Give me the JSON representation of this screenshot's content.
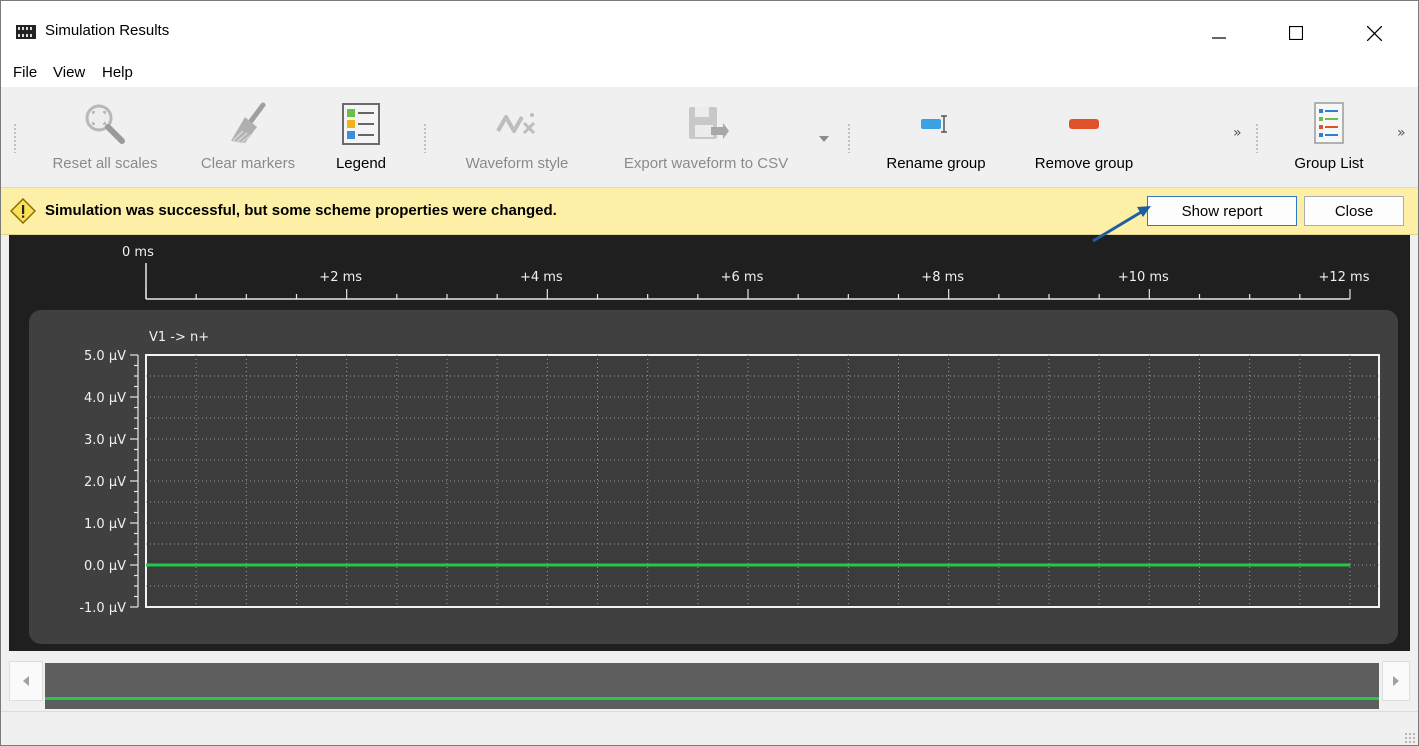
{
  "window": {
    "title": "Simulation Results",
    "controls": {
      "minimize": "—",
      "maximize": "☐",
      "close": "✕"
    }
  },
  "menu": [
    "File",
    "View",
    "Help"
  ],
  "toolbar": {
    "reset_scales": "Reset all scales",
    "clear_markers": "Clear markers",
    "legend": "Legend",
    "waveform_style": "Waveform style",
    "export_csv": "Export waveform to CSV",
    "rename_group": "Rename group",
    "remove_group": "Remove group",
    "group_list": "Group List",
    "overflow": "»"
  },
  "notification": {
    "message": "Simulation was successful, but some scheme properties were changed.",
    "show_report": "Show report",
    "close": "Close"
  },
  "timeline": {
    "ticks": [
      "0 ms",
      "+2 ms",
      "+4 ms",
      "+6 ms",
      "+8 ms",
      "+10 ms",
      "+12 ms"
    ]
  },
  "chart_data": {
    "type": "line",
    "title": "V1 -> n+",
    "xlabel": "",
    "ylabel": "",
    "x_unit": "ms",
    "y_unit": "µV",
    "xlim": [
      0,
      12
    ],
    "ylim": [
      -1.0,
      5.0
    ],
    "y_ticks": [
      "5.0 µV",
      "4.0 µV",
      "3.0 µV",
      "2.0 µV",
      "1.0 µV",
      "0.0 µV",
      "-1.0 µV"
    ],
    "grid": true,
    "series": [
      {
        "x": [
          0,
          12
        ],
        "y": [
          0,
          0
        ],
        "color": "#22c94a"
      }
    ]
  },
  "colors": {
    "trace": "#22c94a",
    "plot_bg": "#404040",
    "notice_bg": "#fdf0a6",
    "arrow": "#1f5fa0"
  }
}
